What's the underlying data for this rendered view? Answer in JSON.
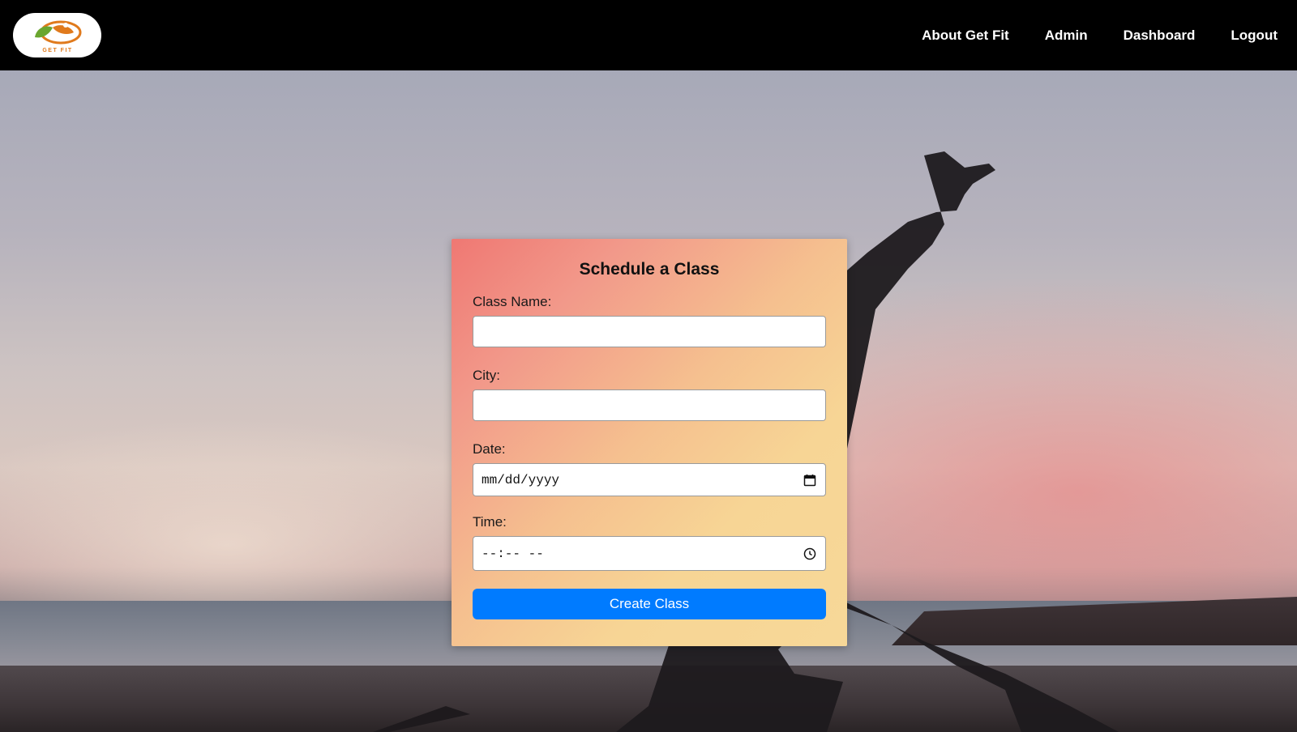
{
  "brand": {
    "logo_text": "GET FIT",
    "colors": {
      "leaf": "#6aa62f",
      "swirl": "#e07a1c"
    }
  },
  "nav": {
    "items": [
      {
        "label": "About Get Fit"
      },
      {
        "label": "Admin"
      },
      {
        "label": "Dashboard"
      },
      {
        "label": "Logout"
      }
    ]
  },
  "form": {
    "title": "Schedule a Class",
    "fields": {
      "class_name": {
        "label": "Class Name:",
        "value": ""
      },
      "city": {
        "label": "City:",
        "value": ""
      },
      "date": {
        "label": "Date:",
        "value": "mm/dd/yyyy",
        "icon": "calendar-icon"
      },
      "time": {
        "label": "Time:",
        "value": "--:-- --",
        "icon": "clock-icon"
      }
    },
    "submit_label": "Create Class",
    "colors": {
      "button": "#007bff"
    }
  }
}
